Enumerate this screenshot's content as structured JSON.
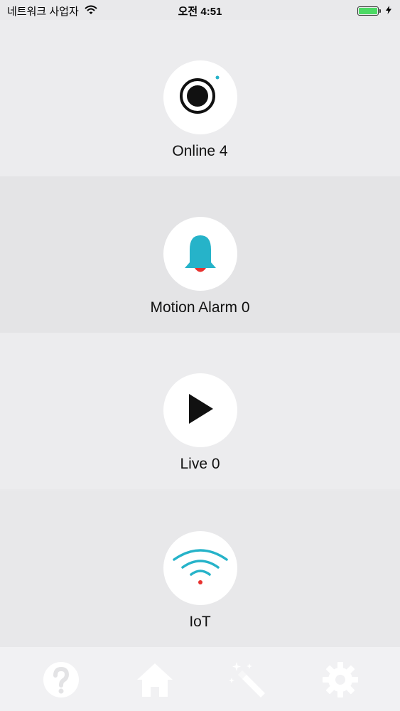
{
  "status_bar": {
    "carrier": "네트워크 사업자",
    "time": "오전 4:51",
    "wifi_icon": "wifi-icon",
    "battery_icon": "battery-icon",
    "charging_icon": "bolt-icon",
    "battery_color": "#4cd964"
  },
  "panels": [
    {
      "label": "Online 4",
      "icon": "record-icon"
    },
    {
      "label": "Motion Alarm 0",
      "icon": "bell-icon",
      "icon_color": "#26b3c9",
      "alert_color": "#e8322f"
    },
    {
      "label": "Live 0",
      "icon": "play-icon"
    },
    {
      "label": "IoT",
      "icon": "wifi-signal-icon",
      "icon_color": "#26b3c9",
      "alert_color": "#e8322f"
    }
  ],
  "tab_bar": {
    "items": [
      {
        "icon": "help-icon"
      },
      {
        "icon": "home-icon"
      },
      {
        "icon": "magic-wand-icon"
      },
      {
        "icon": "gear-icon"
      }
    ]
  },
  "colors": {
    "accent": "#26b3c9",
    "alert": "#e8322f",
    "background": "#e9e9eb"
  }
}
